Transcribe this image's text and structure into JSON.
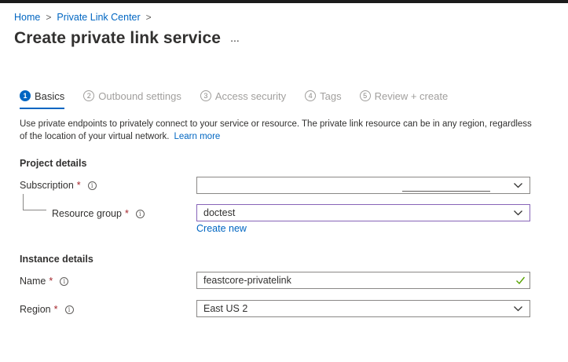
{
  "breadcrumb": {
    "home": "Home",
    "private_link_center": "Private Link Center",
    "separator": ">"
  },
  "page": {
    "title": "Create private link service",
    "more": "..."
  },
  "tabs": [
    {
      "num": "1",
      "label": "Basics",
      "active": true
    },
    {
      "num": "2",
      "label": "Outbound settings"
    },
    {
      "num": "3",
      "label": "Access security"
    },
    {
      "num": "4",
      "label": "Tags"
    },
    {
      "num": "5",
      "label": "Review + create"
    }
  ],
  "description": {
    "text": "Use private endpoints to privately connect to your service or resource. The private link resource can be in any region, regardless of the location of your virtual network.",
    "learn_more": "Learn more"
  },
  "project_details": {
    "heading": "Project details",
    "subscription": {
      "label": "Subscription",
      "required": "*",
      "value": ""
    },
    "resource_group": {
      "label": "Resource group",
      "required": "*",
      "value": "doctest",
      "create_new": "Create new"
    }
  },
  "instance_details": {
    "heading": "Instance details",
    "name": {
      "label": "Name",
      "required": "*",
      "value": "feastcore-privatelink"
    },
    "region": {
      "label": "Region",
      "required": "*",
      "value": "East US 2"
    }
  },
  "icons": {
    "info": "i",
    "info_icon": "info-icon",
    "chevron": "chevron-down-icon",
    "check": "checkmark-icon"
  },
  "colors": {
    "link": "#0066c2",
    "required": "#a4262c",
    "valid": "#57a300",
    "focus": "#8764b8"
  }
}
